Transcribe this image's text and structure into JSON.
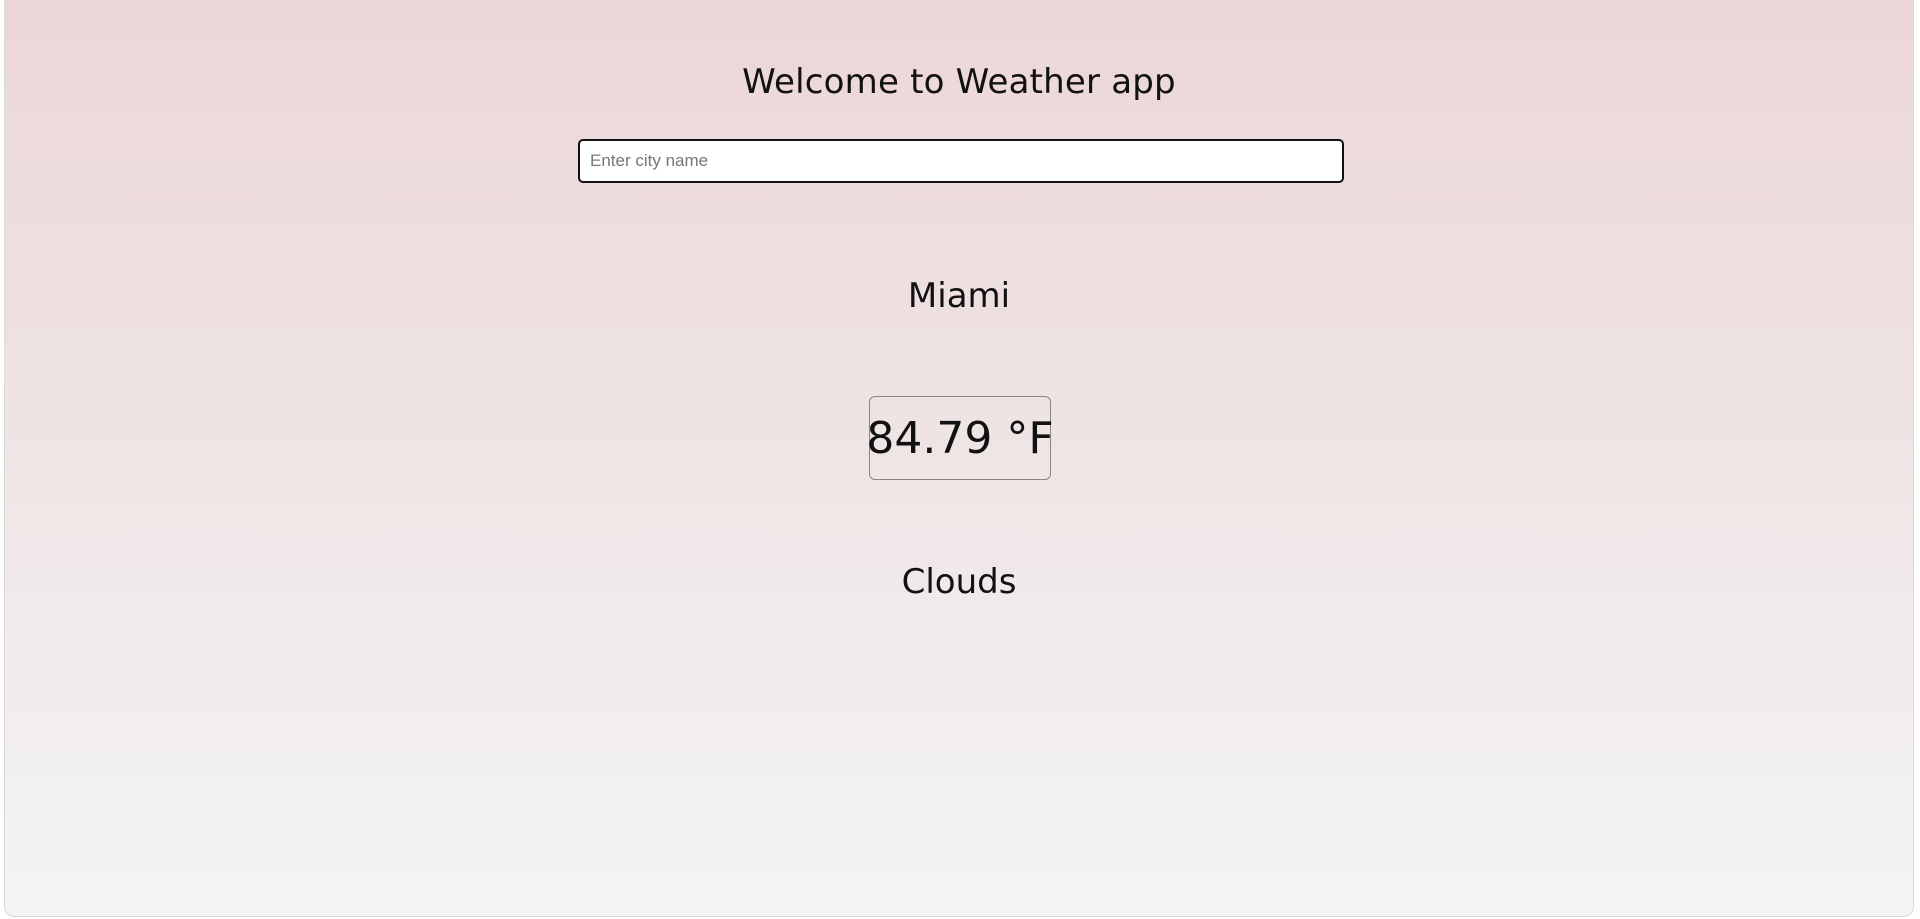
{
  "app": {
    "title": "Welcome to Weather app"
  },
  "search": {
    "placeholder": "Enter city name",
    "value": ""
  },
  "weather": {
    "city": "Miami",
    "temperature": "84.79 °F",
    "condition": "Clouds"
  },
  "colors": {
    "background_top": "#ecd6d7",
    "background_bottom": "#f4f4f4",
    "text": "#111111"
  }
}
